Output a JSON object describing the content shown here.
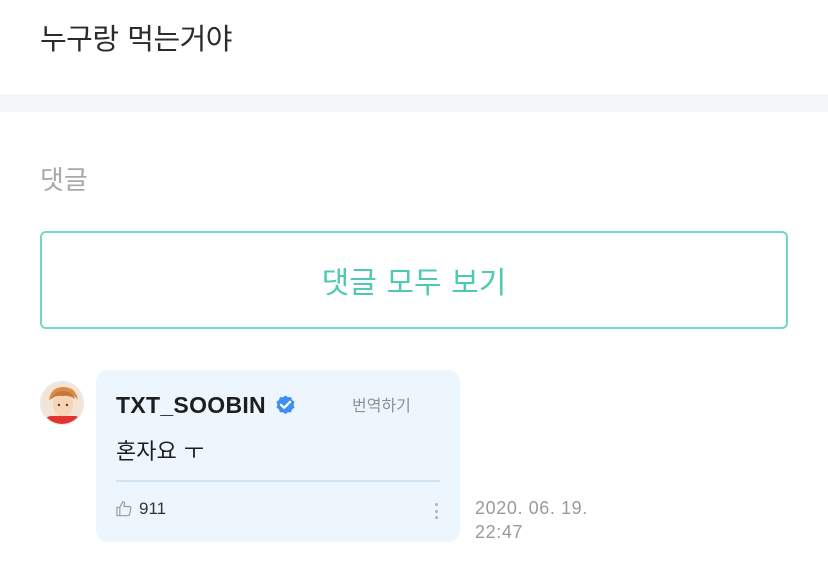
{
  "post": {
    "text": "누구랑 먹는거야"
  },
  "comments": {
    "section_title": "댓글",
    "view_all_label": "댓글 모두 보기",
    "items": [
      {
        "author": "TXT_SOOBIN",
        "verified": true,
        "translate_label": "번역하기",
        "body": "혼자요 ㅜ",
        "likes": "911",
        "date": "2020. 06. 19.",
        "time": "22:47"
      }
    ]
  },
  "colors": {
    "accent": "#4fc9b3",
    "bubble": "#eef6fd",
    "verified": "#3d8ff3"
  },
  "icons": {
    "verified": "verified-badge-icon",
    "like": "thumbs-up-icon",
    "more": "more-vertical-icon"
  }
}
